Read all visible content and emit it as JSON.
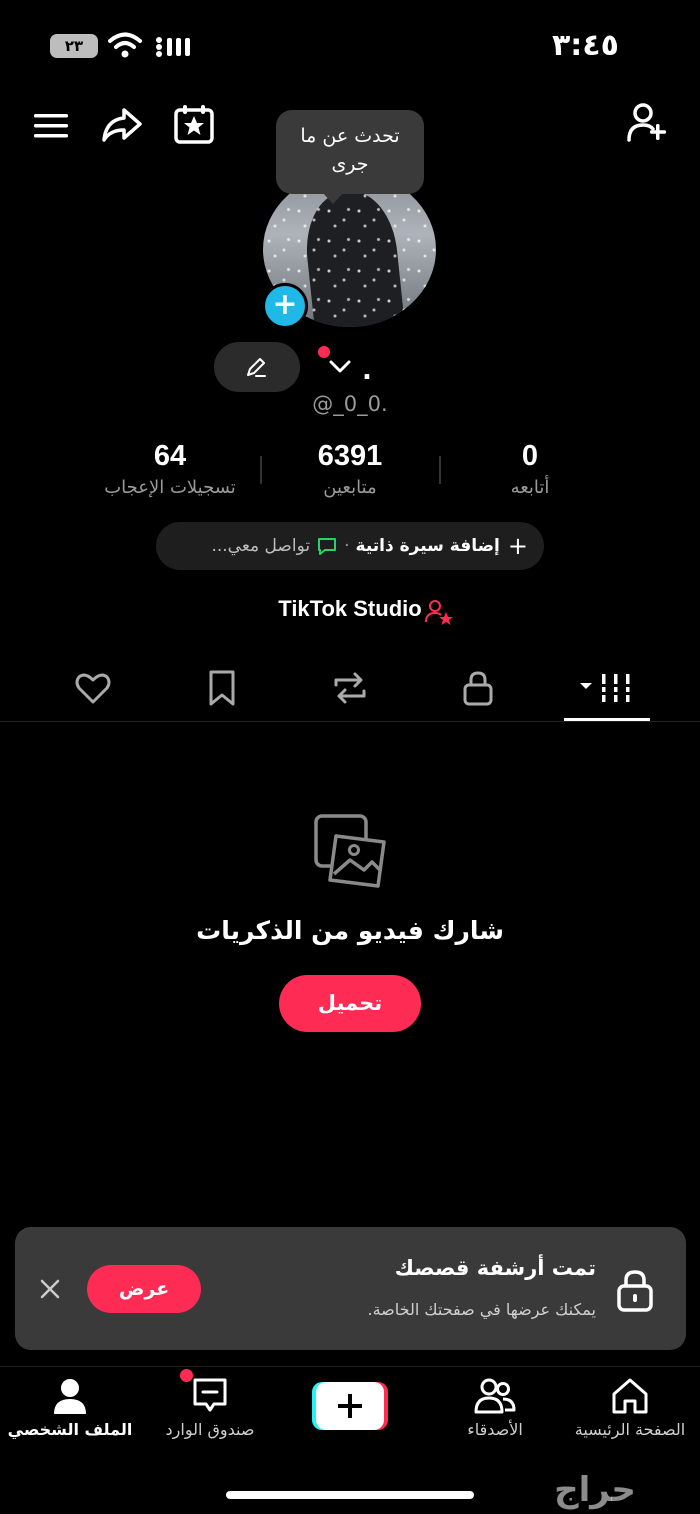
{
  "status_bar": {
    "time": "٣:٤٥",
    "battery": "٢٣"
  },
  "tooltip": {
    "text_line1": "تحدث عن ما",
    "text_line2": "جرى"
  },
  "profile": {
    "name": ".",
    "handle": "@_0_0.",
    "stats": {
      "likes": {
        "value": "64",
        "label": "تسجيلات الإعجاب"
      },
      "followers": {
        "value": "6391",
        "label": "متابعين"
      },
      "following": {
        "value": "0",
        "label": "أتابعه"
      }
    },
    "bio_pill": {
      "add_bio": "إضافة سيرة ذاتية",
      "contact": "تواصل معي..."
    },
    "studio_label": "TikTok Studio"
  },
  "tabs": [
    "videos-grid",
    "private-lock",
    "reposts",
    "saved-bookmark",
    "liked-heart"
  ],
  "empty_state": {
    "title": "شارك فيديو من الذكريات",
    "button": "تحميل"
  },
  "toast": {
    "title": "تمت أرشفة قصصك",
    "subtitle": "يمكنك عرضها في صفحتك الخاصة.",
    "view_button": "عرض"
  },
  "bottom_nav": {
    "home": "الصفحة الرئيسية",
    "friends": "الأصدقاء",
    "inbox": "صندوق الوارد",
    "profile": "الملف الشخصي"
  },
  "watermark": "حراج",
  "colors": {
    "accent": "#fe2c55",
    "plus_blue": "#20b8e6",
    "background": "#000000"
  }
}
